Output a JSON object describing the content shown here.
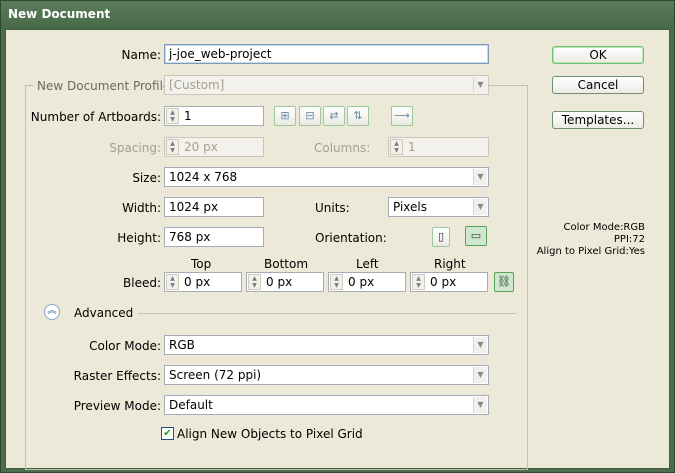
{
  "window": {
    "title": "New Document"
  },
  "name": {
    "label": "Name:",
    "value": "j-joe_web-project"
  },
  "profile": {
    "label": "New Document Profile:",
    "value": "[Custom]"
  },
  "artboards": {
    "label": "Number of Artboards:",
    "value": "1"
  },
  "spacing": {
    "label": "Spacing:",
    "value": "20 px"
  },
  "columns": {
    "label": "Columns:",
    "value": "1"
  },
  "size": {
    "label": "Size:",
    "value": "1024 x 768"
  },
  "width": {
    "label": "Width:",
    "value": "1024 px"
  },
  "units": {
    "label": "Units:",
    "value": "Pixels"
  },
  "height": {
    "label": "Height:",
    "value": "768 px"
  },
  "orientation": {
    "label": "Orientation:",
    "selected": "landscape"
  },
  "bleed": {
    "label": "Bleed:",
    "top_label": "Top",
    "top": "0 px",
    "bottom_label": "Bottom",
    "bottom": "0 px",
    "left_label": "Left",
    "left": "0 px",
    "right_label": "Right",
    "right": "0 px"
  },
  "advanced": {
    "label": "Advanced"
  },
  "color_mode": {
    "label": "Color Mode:",
    "value": "RGB"
  },
  "raster_effects": {
    "label": "Raster Effects:",
    "value": "Screen (72 ppi)"
  },
  "preview_mode": {
    "label": "Preview Mode:",
    "value": "Default"
  },
  "align_pixel_grid": {
    "label": "Align New Objects to Pixel Grid",
    "checked": true
  },
  "buttons": {
    "ok": "OK",
    "cancel": "Cancel",
    "templates": "Templates..."
  },
  "summary": {
    "color_mode": "Color Mode:RGB",
    "ppi": "PPI:72",
    "align": "Align to Pixel Grid:Yes"
  },
  "colors": {
    "titlebar": "#4f704f",
    "accent_green": "#6fbf6f",
    "dialog_bg": "#ece9d8"
  },
  "icons": [
    "arrange-grid-by-row-icon",
    "arrange-grid-by-column-icon",
    "arrange-by-row-icon",
    "arrange-by-column-icon",
    "layout-rtl-icon",
    "portrait-icon",
    "landscape-icon",
    "link-bleed-icon",
    "collapse-advanced-icon",
    "dropdown-arrow-icon"
  ]
}
